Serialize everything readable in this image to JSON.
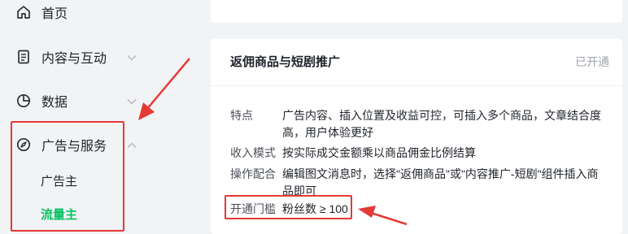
{
  "sidebar": {
    "items": [
      {
        "label": "首页",
        "icon": "home-icon"
      },
      {
        "label": "内容与互动",
        "icon": "document-icon"
      },
      {
        "label": "数据",
        "icon": "pie-chart-icon"
      },
      {
        "label": "广告与服务",
        "icon": "compass-icon"
      }
    ],
    "sub_items": [
      {
        "label": "广告主"
      },
      {
        "label": "流量主"
      }
    ]
  },
  "card": {
    "title": "返佣商品与短剧推广",
    "status": "已开通",
    "rows": [
      {
        "key": "特点",
        "value": "广告内容、插入位置及收益可控，可插入多个商品，文章结合度高，用户体验更好"
      },
      {
        "key": "收入模式",
        "value": "按实际成交金额乘以商品佣金比例结算"
      },
      {
        "key": "操作配合",
        "value": "编辑图文消息时，选择\"返佣商品\"或\"内容推广-短剧\"组件插入商品即可"
      },
      {
        "key": "开通门槛",
        "value": "粉丝数 ≥ 100"
      }
    ]
  },
  "colors": {
    "accent": "#07c160",
    "annotation": "#e53935"
  }
}
